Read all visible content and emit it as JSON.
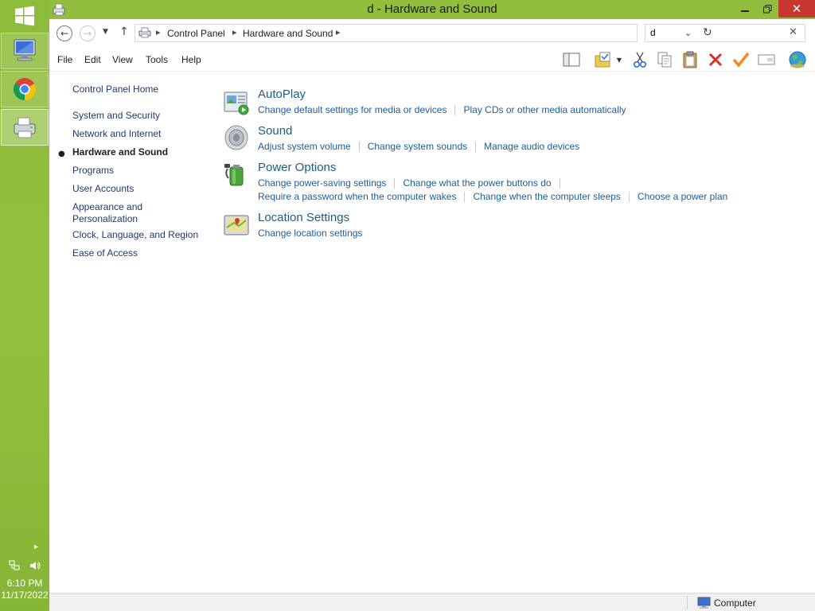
{
  "taskbar": {
    "clock_time": "6:10 PM",
    "clock_date": "11/17/2022",
    "apps": [
      {
        "name": "computer-app",
        "icon": "computer-icon"
      },
      {
        "name": "chrome-app",
        "icon": "chrome-icon"
      },
      {
        "name": "control-panel-app",
        "icon": "printer-icon"
      }
    ],
    "tray_icons": [
      "network-icon",
      "volume-icon"
    ],
    "accent": "#8dbb3a"
  },
  "window": {
    "title": "d - Hardware and Sound",
    "close_color": "#c7372f"
  },
  "address": {
    "crumbs": [
      "Control Panel",
      "Hardware and Sound"
    ],
    "search_value": "d"
  },
  "menu": [
    "File",
    "Edit",
    "View",
    "Tools",
    "Help"
  ],
  "toolbar": [
    "layout-icon",
    "folder-check-icon",
    "cut-icon",
    "copy-icon",
    "paste-icon",
    "delete-icon",
    "checkmark-icon",
    "rename-icon",
    "globe-icon"
  ],
  "leftnav": {
    "home": "Control Panel Home",
    "items": [
      "System and Security",
      "Network and Internet",
      "Hardware and Sound",
      "Programs",
      "User Accounts",
      "Appearance and Personalization",
      "Clock, Language, and Region",
      "Ease of Access"
    ],
    "appearance_line1": "Appearance and",
    "appearance_line2": "Personalization",
    "current_index": 2
  },
  "categories": [
    {
      "title": "AutoPlay",
      "icon": "autoplay-icon",
      "rows": [
        [
          "Change default settings for media or devices",
          "Play CDs or other media automatically"
        ]
      ]
    },
    {
      "title": "Sound",
      "icon": "speaker-icon",
      "rows": [
        [
          "Adjust system volume",
          "Change system sounds",
          "Manage audio devices"
        ]
      ]
    },
    {
      "title": "Power Options",
      "icon": "battery-icon",
      "rows": [
        [
          "Change power-saving settings",
          "Change what the power buttons do"
        ],
        [
          "Require a password when the computer wakes",
          "Change when the computer sleeps",
          "Choose a power plan"
        ]
      ]
    },
    {
      "title": "Location Settings",
      "icon": "location-icon",
      "rows": [
        [
          "Change location settings"
        ]
      ]
    }
  ],
  "status": {
    "text": "Computer",
    "icon": "computer-icon"
  },
  "colors": {
    "link": "#1c5d9c",
    "heading": "#1e5e7e",
    "title_bar": "#91bf3d"
  }
}
